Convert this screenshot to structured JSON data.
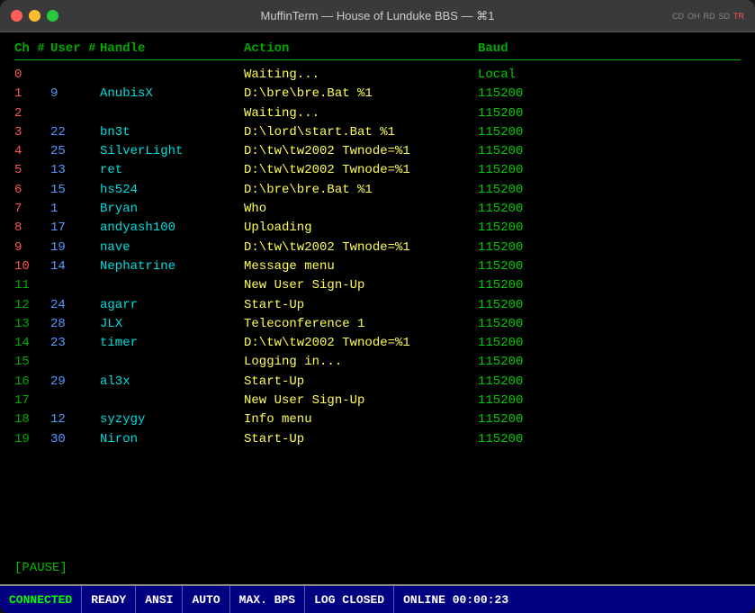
{
  "window": {
    "title": "MuffinTerm — House of Lunduke BBS — ⌘1"
  },
  "indicators": [
    "CD",
    "OH",
    "RD",
    "SD",
    "TR"
  ],
  "header": {
    "ch": "Ch #",
    "user": "User #",
    "handle": "Handle",
    "action": "Action",
    "baud": "Baud"
  },
  "rows": [
    {
      "ch": "0",
      "user": "",
      "handle": "",
      "action": "Waiting...",
      "baud": "Local"
    },
    {
      "ch": "1",
      "user": "9",
      "handle": "AnubisX",
      "action": "D:\\bre\\bre.Bat %1",
      "baud": "115200"
    },
    {
      "ch": "2",
      "user": "",
      "handle": "",
      "action": "Waiting...",
      "baud": "115200"
    },
    {
      "ch": "3",
      "user": "22",
      "handle": "bn3t",
      "action": "D:\\lord\\start.Bat %1",
      "baud": "115200"
    },
    {
      "ch": "4",
      "user": "25",
      "handle": "SilverLight",
      "action": "D:\\tw\\tw2002 Twnode=%1",
      "baud": "115200"
    },
    {
      "ch": "5",
      "user": "13",
      "handle": "ret",
      "action": "D:\\tw\\tw2002 Twnode=%1",
      "baud": "115200"
    },
    {
      "ch": "6",
      "user": "15",
      "handle": "hs524",
      "action": "D:\\bre\\bre.Bat %1",
      "baud": "115200"
    },
    {
      "ch": "7",
      "user": "1",
      "handle": "Bryan",
      "action": "Who",
      "baud": "115200"
    },
    {
      "ch": "8",
      "user": "17",
      "handle": "andyash100",
      "action": "Uploading",
      "baud": "115200"
    },
    {
      "ch": "9",
      "user": "19",
      "handle": "nave",
      "action": "D:\\tw\\tw2002 Twnode=%1",
      "baud": "115200"
    },
    {
      "ch": "10",
      "user": "14",
      "handle": "Nephatrine",
      "action": "Message menu",
      "baud": "115200"
    },
    {
      "ch": "11",
      "user": "",
      "handle": "",
      "action": "New User Sign-Up",
      "baud": "115200"
    },
    {
      "ch": "12",
      "user": "24",
      "handle": "agarr",
      "action": "Start-Up",
      "baud": "115200"
    },
    {
      "ch": "13",
      "user": "28",
      "handle": "JLX",
      "action": "Teleconference 1",
      "baud": "115200"
    },
    {
      "ch": "14",
      "user": "23",
      "handle": "timer",
      "action": "D:\\tw\\tw2002 Twnode=%1",
      "baud": "115200"
    },
    {
      "ch": "15",
      "user": "",
      "handle": "",
      "action": "Logging in...",
      "baud": "115200"
    },
    {
      "ch": "16",
      "user": "29",
      "handle": "al3x",
      "action": "Start-Up",
      "baud": "115200"
    },
    {
      "ch": "17",
      "user": "",
      "handle": "",
      "action": "New User Sign-Up",
      "baud": "115200"
    },
    {
      "ch": "18",
      "user": "12",
      "handle": "syzygy",
      "action": "Info menu",
      "baud": "115200"
    },
    {
      "ch": "19",
      "user": "30",
      "handle": "Niron",
      "action": "Start-Up",
      "baud": "115200"
    }
  ],
  "pause": "[PAUSE]",
  "statusbar": {
    "connected": "CONNECTED",
    "ready": "READY",
    "ansi": "ANSI",
    "auto": "AUTO",
    "maxbps": "MAX. BPS",
    "logclosed": "LOG CLOSED",
    "online": "ONLINE 00:00:23"
  }
}
